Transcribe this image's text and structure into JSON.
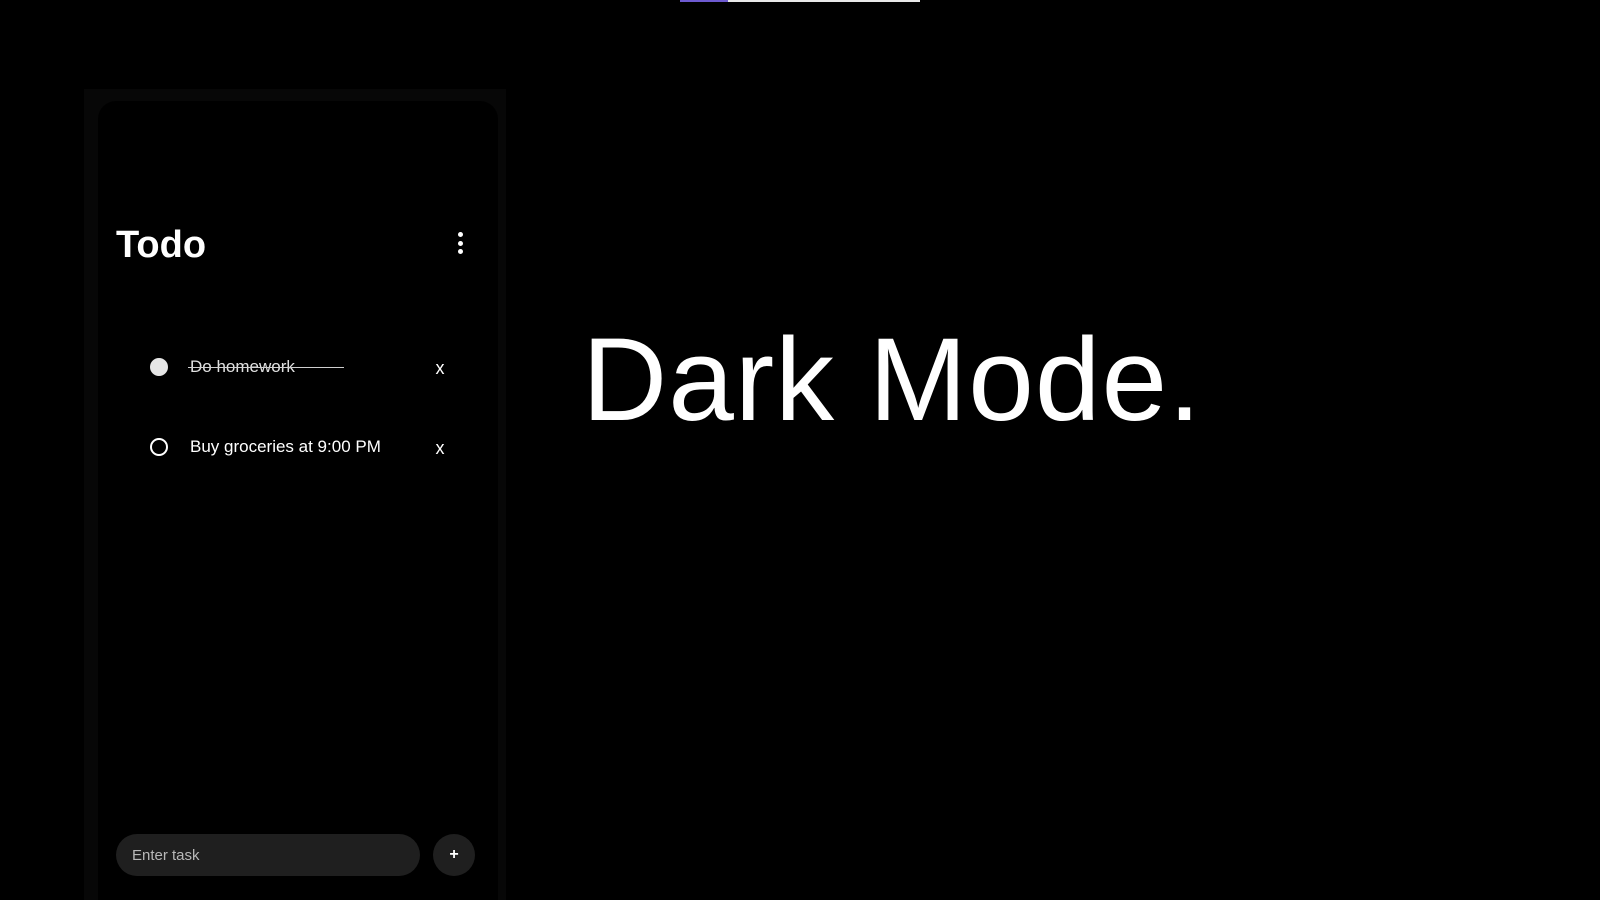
{
  "loading_bar": {
    "progress": 0.2,
    "accent_color": "#6d5ad0"
  },
  "app": {
    "title": "Todo",
    "menu_icon": "more-vertical-icon"
  },
  "todos": [
    {
      "text": "Do homework",
      "done": true,
      "delete_label": "x"
    },
    {
      "text": "Buy groceries at 9:00 PM",
      "done": false,
      "delete_label": "x"
    }
  ],
  "composer": {
    "placeholder": "Enter task",
    "value": "",
    "add_label": "+"
  },
  "hero": {
    "text": "Dark Mode."
  }
}
